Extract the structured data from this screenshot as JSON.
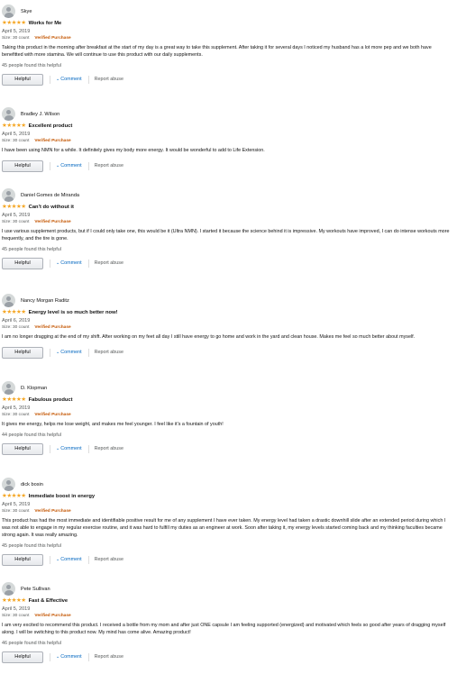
{
  "reviews": [
    {
      "name": "Skye",
      "stars": "★★★★★",
      "title": "Works for Me",
      "date": "April 5, 2019",
      "size": "Size: 30 count",
      "verified": "Verified Purchase",
      "body": "Taking this product in the morning after breakfast at the start of my day is a great way to take this supplement. After taking it for several days I noticed my husband has a lot more pep and we both have benefitted with more stamina. We will continue to use this product with our daily supplements.",
      "found": "45 people found this helpful"
    },
    {
      "name": "Bradley J. Wilson",
      "stars": "★★★★★",
      "title": "Excellent product",
      "date": "April 5, 2019",
      "size": "Size: 30 count",
      "verified": "Verified Purchase",
      "body": "I have been using NMN for a while. It definitely gives my body more energy. It would be wonderful to add to Life Extension.",
      "found": ""
    },
    {
      "name": "Daniel Gomes de Miranda",
      "stars": "★★★★★",
      "title": "Can't do without it",
      "date": "April 5, 2019",
      "size": "Size: 30 count",
      "verified": "Verified Purchase",
      "body": "I use various supplement products, but if I could only take one, this would be it (Ultra NMN). I started it because the science behind it is impressive. My workouts have improved, I can do intense workouts more frequently, and the tire is gone.",
      "found": "45 people found this helpful"
    },
    {
      "name": "Nancy Morgan Raditz",
      "stars": "★★★★★",
      "title": "Energy level is so much better now!",
      "date": "April 6, 2019",
      "size": "Size: 30 count",
      "verified": "Verified Purchase",
      "body": "I am no longer dragging at the end of my shift. After working on my feet all day I still have energy to go home and work in the yard and clean house. Makes me feel so much better about myself.",
      "found": ""
    },
    {
      "name": "D. Klopman",
      "stars": "★★★★★",
      "title": "Fabulous product",
      "date": "April 5, 2019",
      "size": "Size: 30 count",
      "verified": "Verified Purchase",
      "body": "It gives me energy, helps me lose weight, and makes me feel younger. I feel like it's a fountain of youth!",
      "found": "44 people found this helpful"
    },
    {
      "name": "dick bosin",
      "stars": "★★★★★",
      "title": "Immediate boost in energy",
      "date": "April 5, 2019",
      "size": "Size: 30 count",
      "verified": "Verified Purchase",
      "body": "This product has had the most immediate and identifiable positive result for me of any supplement I have ever taken. My energy level had taken a drastic downhill slide after an extended period during which I was not able to engage in my regular exercise routine, and it was hard to fulfill my duties as an engineer at work. Soon after taking it, my energy levels started coming back and my thinking faculties became strong again. It was really amazing.",
      "found": "45 people found this helpful"
    },
    {
      "name": "Pete Sullivan",
      "stars": "★★★★★",
      "title": "Fast & Effective",
      "date": "April 5, 2019",
      "size": "Size: 30 count",
      "verified": "Verified Purchase",
      "body": "I am very excited to recommend this product. I received a bottle from my mom and after just ONE capsule I am feeling supported (energized) and motivated which feels so good after years of dragging myself along. I will be switching to this product now. My mind has come alive. Amazing product!",
      "found": "46 people found this helpful"
    }
  ],
  "labels": {
    "helpful": "Helpful",
    "comment": "Comment",
    "report": "Report abuse",
    "chevron": "⌄"
  },
  "colors": {
    "star": "#f5a623",
    "verified": "#c45500",
    "link": "#0066c0",
    "muted": "#565959"
  }
}
